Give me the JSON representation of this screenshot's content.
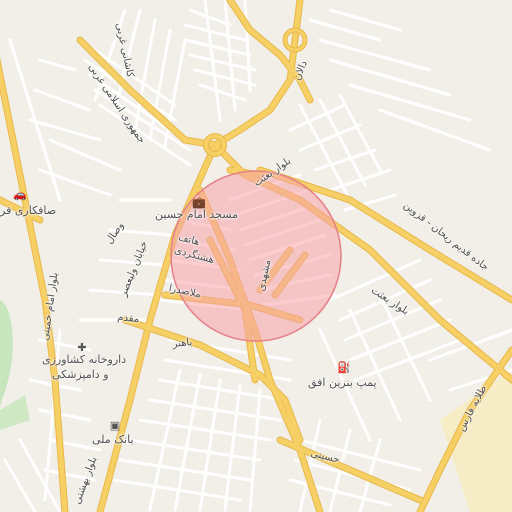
{
  "map": {
    "colors": {
      "background": "#f2efe9",
      "minor_road": "#ffffff",
      "major_road": "#f6cf65",
      "major_road_casing": "#e8b84a",
      "park": "#c8e6bd",
      "sand": "#f6ecc6",
      "circle_fill": "#f7a3a9",
      "circle_stroke": "#e58088"
    },
    "highlight_circle": {
      "shape": "circle",
      "style": "translucent-red"
    },
    "labels": {
      "dalan": "دالان",
      "boulevard_besat_top": "بلوار بعثت",
      "boulevard_besat_right": "بلوار بعثت",
      "jade_qadim": "جاده قدیم ریحان - قزوین",
      "kashani_gharbi": "کاشانی غربی",
      "jomhouri_eslami_gharbi": "جمهوری اسلامی غربی",
      "mosque": "مسجد امام حسین",
      "safakari": "صافکاری فر",
      "vesal": "وصال",
      "khiaban_valiasr": "خیابان ولیعصر",
      "hatef": "هاتف",
      "hashtgerdi": "هشتگردی",
      "mashhadi": "مشهدی",
      "molasadra": "ملاصدرا",
      "moghadam": "مقدم",
      "bahonar": "باهنر",
      "boulevard_imam_khomeini": "بلوار امام خمینی",
      "darookhaneh_line1": "داروخانه کشاورزی",
      "darookhaneh_line2": "و دامپزشکی",
      "pump_benzin": "پمپ بنزین افق",
      "bank_melli": "بانک ملی",
      "boulevard_beheshti": "بلوار بهشتی",
      "hosaini": "حسینی",
      "tolaye_fars": "طلایه فارس"
    },
    "icons": {
      "mosque": "briefcase-icon",
      "safakari": "car-icon",
      "darookhaneh": "pharmacy-icon",
      "pump": "fuel-icon",
      "bank": "bank-icon"
    }
  }
}
